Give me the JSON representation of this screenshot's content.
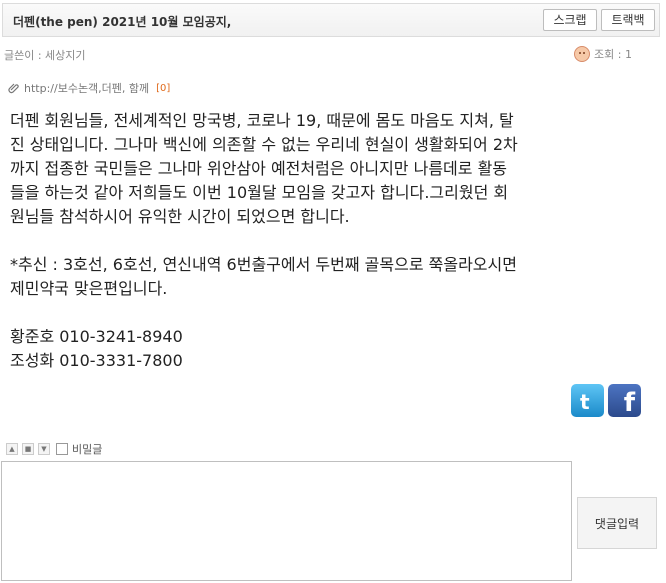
{
  "header": {
    "title": "더펜(the pen) 2021년 10월 모임공지,",
    "scrap_label": "스크랩",
    "trackback_label": "트랙백"
  },
  "meta": {
    "author": "글쓴이 : 세상지기",
    "views": "조회 : 1"
  },
  "link": {
    "text": "http://보수논객,더펜, 함께",
    "count": "[0]"
  },
  "content": {
    "paragraphs": [
      "더펜 회원님들, 전세계적인 망국병, 코로나 19, 때문에 몸도 마음도 지쳐, 탈\n진 상태입니다. 그나마 백신에 의존할 수 없는 우리네 현실이 생활화되어 2차\n까지 접종한 국민들은 그나마 위안삼아 예전처럼은 아니지만 나름데로 활동\n들을 하는것 같아 저희들도 이번 10월달 모임을 갖고자 합니다.그리웠던 회\n원님들 참석하시어 유익한 시간이 되었으면 합니다.",
      "*추신 : 3호선, 6호선, 연신내역 6번출구에서 두번째 골목으로 쭉올라오시면\n제민약국 맞은편입니다.",
      "황준호 010-3241-8940\n조성화 010-3331-7800"
    ]
  },
  "social": {
    "twitter": "twitter-icon",
    "facebook_glyph": "f"
  },
  "comment": {
    "secret_label": "비밀글",
    "submit_label": "댓글입력"
  }
}
